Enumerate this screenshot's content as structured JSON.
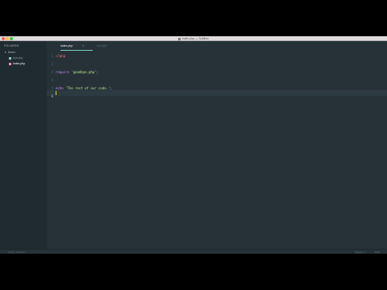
{
  "window": {
    "title": "index.php — Sublime"
  },
  "sidebar": {
    "header": "FOLDERS",
    "folder": "Demo",
    "files": [
      {
        "label": "bye.php",
        "active": false
      },
      {
        "label": "index.php",
        "active": true
      }
    ]
  },
  "tabs": [
    {
      "label": "index.php",
      "active": true
    },
    {
      "label": "bye.php",
      "active": false
    }
  ],
  "editor": {
    "line_numbers": [
      "1",
      "2",
      "3",
      "4",
      "5",
      "6"
    ],
    "lines": [
      {
        "parts": [
          {
            "text": "<?php",
            "cls": "tag"
          }
        ]
      },
      {
        "parts": []
      },
      {
        "parts": [
          {
            "text": "require",
            "cls": "kw"
          },
          {
            "text": " ",
            "cls": ""
          },
          {
            "text": "'goodbye.php'",
            "cls": "str"
          },
          {
            "text": ";",
            "cls": "punc"
          }
        ]
      },
      {
        "parts": []
      },
      {
        "parts": [
          {
            "text": "echo",
            "cls": "kw"
          },
          {
            "text": " ",
            "cls": ""
          },
          {
            "text": "'The rest of our code.'",
            "cls": "str"
          },
          {
            "text": ";",
            "cls": "punc"
          }
        ]
      },
      {
        "parts": []
      }
    ]
  },
  "status": {
    "left": "Line 6, Column 1",
    "syntax": "Spaces: 4",
    "lang": "PHP"
  }
}
